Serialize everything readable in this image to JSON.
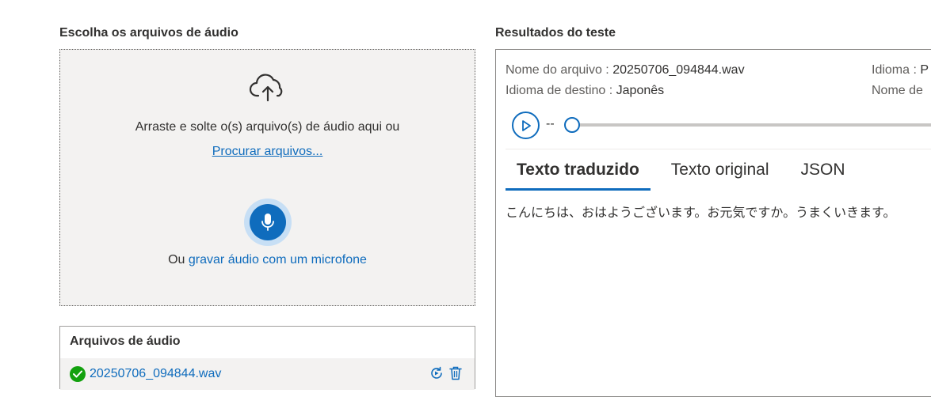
{
  "left_panel": {
    "title": "Escolha os arquivos de áudio",
    "dropzone": {
      "upload_icon": "cloud-upload-icon",
      "instruction": "Arraste e solte o(s) arquivo(s) de áudio aqui ou",
      "browse_link": "Procurar arquivos...",
      "mic_icon": "microphone-icon",
      "mic_prefix": "Ou",
      "mic_link": "gravar áudio com um microfone"
    },
    "files": {
      "header": "Arquivos de áudio",
      "items": [
        {
          "name": "20250706_094844.wav",
          "status_icon": "success-check-icon",
          "actions": [
            "refresh-icon",
            "trash-icon"
          ]
        }
      ]
    }
  },
  "results": {
    "title": "Resultados do teste",
    "file_label": "Nome do arquivo : ",
    "file_value": "20250706_094844.wav",
    "target_label": "Idioma de destino : ",
    "target_value": "Japonês",
    "lang_label": "Idioma : ",
    "lang_value": "P",
    "name2_label": "Nome de",
    "player": {
      "time": "--",
      "progress": 0
    },
    "tabs": [
      {
        "label": "Texto traduzido",
        "active": true
      },
      {
        "label": "Texto original",
        "active": false
      },
      {
        "label": "JSON",
        "active": false
      }
    ],
    "translated_text": "こんにちは、おはようございます。お元気ですか。うまくいきます。"
  },
  "colors": {
    "accent": "#0f6cbd",
    "success": "#13a10e",
    "panel_bg": "#f3f2f1"
  }
}
